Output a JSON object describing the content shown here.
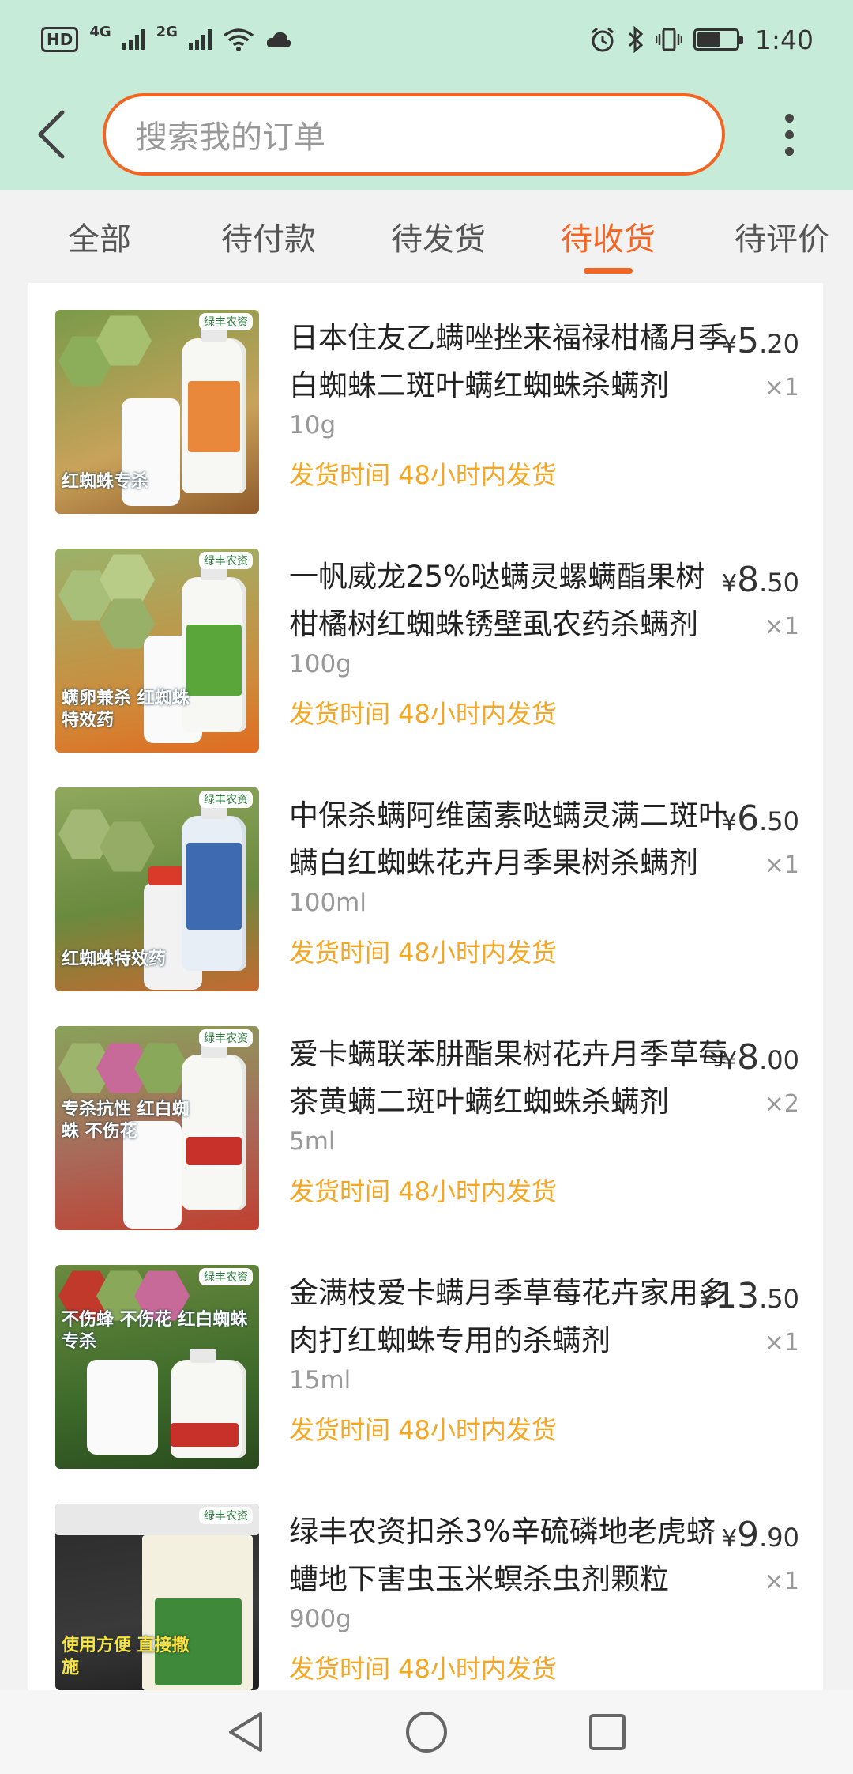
{
  "status_bar": {
    "hd": "HD",
    "net1": "4G",
    "net2": "2G",
    "time": "1:40",
    "icons": [
      "hd-icon",
      "signal-icon",
      "wifi-icon",
      "cloud-icon",
      "alarm-icon",
      "bluetooth-icon",
      "vibrate-icon",
      "battery-icon"
    ]
  },
  "header": {
    "search_placeholder": "搜索我的订单",
    "back_icon": "chevron-left-icon",
    "more_icon": "more-vertical-icon"
  },
  "tabs": [
    {
      "label": "全部"
    },
    {
      "label": "待付款"
    },
    {
      "label": "待发货"
    },
    {
      "label": "待收货",
      "active": true
    },
    {
      "label": "待评价"
    }
  ],
  "colors": {
    "header_bg": "#c6ebd8",
    "accent": "#f26522",
    "ship_text": "#f5a623"
  },
  "orders": [
    {
      "title": "日本住友乙螨唑挫来福禄柑橘月季白蜘蛛二斑叶螨红蜘蛛杀螨剂",
      "sku": "10g",
      "ship": "发货时间 48小时内发货",
      "currency": "¥",
      "price_int": "5",
      "price_dec": ".20",
      "qty": "×1",
      "thumb_caption": "红蜘蛛专杀"
    },
    {
      "title": "一帆威龙25%哒螨灵螺螨酯果树柑橘树红蜘蛛锈壁虱农药杀螨剂",
      "sku": "100g",
      "ship": "发货时间 48小时内发货",
      "currency": "¥",
      "price_int": "8",
      "price_dec": ".50",
      "qty": "×1",
      "thumb_caption": "螨卵兼杀 红蜘蛛特效药"
    },
    {
      "title": "中保杀螨阿维菌素哒螨灵满二斑叶螨白红蜘蛛花卉月季果树杀螨剂",
      "sku": "100ml",
      "ship": "发货时间 48小时内发货",
      "currency": "¥",
      "price_int": "6",
      "price_dec": ".50",
      "qty": "×1",
      "thumb_caption": "红蜘蛛特效药"
    },
    {
      "title": "爱卡螨联苯肼酯果树花卉月季草莓茶黄螨二斑叶螨红蜘蛛杀螨剂",
      "sku": "5ml",
      "ship": "发货时间 48小时内发货",
      "currency": "¥",
      "price_int": "8",
      "price_dec": ".00",
      "qty": "×2",
      "thumb_caption": "专杀抗性 红白蜘蛛 不伤花"
    },
    {
      "title": "金满枝爱卡螨月季草莓花卉家用多肉打红蜘蛛专用的杀螨剂",
      "sku": "15ml",
      "ship": "发货时间 48小时内发货",
      "currency": "¥",
      "price_int": "13",
      "price_dec": ".50",
      "qty": "×1",
      "thumb_caption": "不伤蜂 不伤花 红白蜘蛛专杀"
    },
    {
      "title": "绿丰农资扣杀3%辛硫磷地老虎蛴螬地下害虫玉米螟杀虫剂颗粒",
      "sku": "900g",
      "ship": "发货时间 48小时内发货",
      "currency": "¥",
      "price_int": "9",
      "price_dec": ".90",
      "qty": "×1",
      "thumb_caption": "使用方便 直接撒施"
    }
  ],
  "navbar": {
    "icons": [
      "back-triangle-icon",
      "home-circle-icon",
      "recents-square-icon"
    ]
  }
}
